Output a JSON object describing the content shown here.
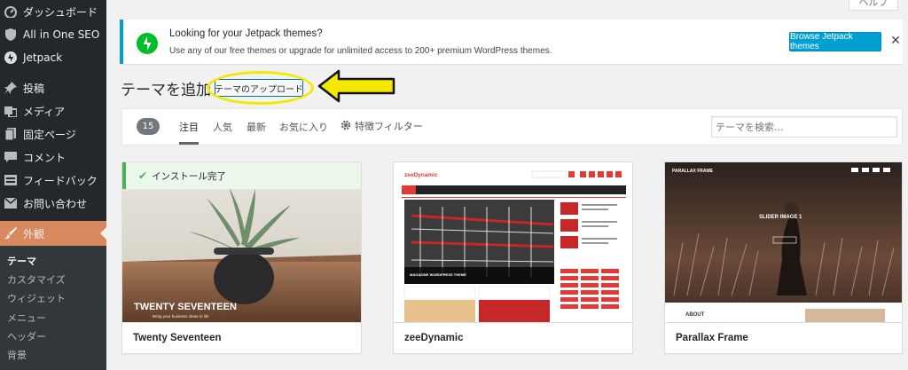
{
  "sidebar": {
    "items": [
      {
        "label": "ダッシュボード",
        "icon": "dashboard-icon"
      },
      {
        "label": "All in One SEO",
        "icon": "shield-icon"
      },
      {
        "label": "Jetpack",
        "icon": "jetpack-icon"
      },
      {
        "label": "投稿",
        "icon": "pin-icon"
      },
      {
        "label": "メディア",
        "icon": "media-icon"
      },
      {
        "label": "固定ページ",
        "icon": "page-icon"
      },
      {
        "label": "コメント",
        "icon": "comment-icon"
      },
      {
        "label": "フィードバック",
        "icon": "feedback-icon"
      },
      {
        "label": "お問い合わせ",
        "icon": "mail-icon"
      },
      {
        "label": "外観",
        "icon": "brush-icon"
      }
    ],
    "submenu": [
      "テーマ",
      "カスタマイズ",
      "ウィジェット",
      "メニュー",
      "ヘッダー",
      "背景"
    ]
  },
  "help": {
    "label": "ヘルプ"
  },
  "notice": {
    "title": "Looking for your Jetpack themes?",
    "text": "Use any of our free themes or upgrade for unlimited access to 200+ premium WordPress themes.",
    "button": "Browse Jetpack themes",
    "close": "✕"
  },
  "page": {
    "title": "テーマを追加",
    "upload_button": "テーマのアップロード"
  },
  "filters": {
    "count": "15",
    "tabs": [
      "注目",
      "人気",
      "最新",
      "お気に入り"
    ],
    "feature_filter": "特徴フィルター",
    "search_placeholder": "テーマを検索..."
  },
  "themes": [
    {
      "name": "Twenty Seventeen",
      "installed": "インストール完了",
      "shot_title": "TWENTY SEVENTEEN",
      "shot_sub": "Bring your business ideas to life"
    },
    {
      "name": "zeeDynamic",
      "shot_logo": "zeeDynamic",
      "shot_caption": "MAGAZINE WORDPRESS THEME"
    },
    {
      "name": "Parallax Frame",
      "shot_logo": "PARALLAX FRAME",
      "shot_slider": "SLIDER IMAGE 1",
      "shot_about": "ABOUT"
    }
  ],
  "colors": {
    "sidebar_bg": "#23282d",
    "active_menu": "#d8895f",
    "notice_accent": "#00a0d2",
    "jetpack_green": "#00be28",
    "highlight_yellow": "#f5e800"
  }
}
